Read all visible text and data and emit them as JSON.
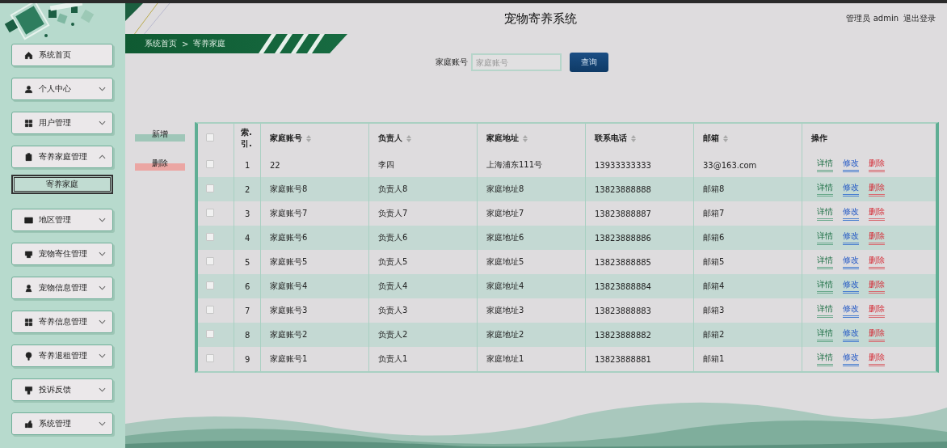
{
  "header": {
    "title": "宠物寄养系统",
    "user": "管理员 admin",
    "logout": "退出登录"
  },
  "breadcrumb": [
    "系统首页",
    ">",
    "寄养家庭"
  ],
  "sidebar": {
    "items": [
      {
        "label": "系统首页",
        "kind": "link"
      },
      {
        "label": "个人中心",
        "kind": "menu",
        "expanded": false
      },
      {
        "label": "用户管理",
        "kind": "menu",
        "expanded": false
      },
      {
        "label": "寄养家庭管理",
        "kind": "menu",
        "expanded": true,
        "children": [
          {
            "label": "寄养家庭",
            "selected": true
          }
        ]
      },
      {
        "label": "地区管理",
        "kind": "menu",
        "expanded": false
      },
      {
        "label": "宠物寄住管理",
        "kind": "menu",
        "expanded": false
      },
      {
        "label": "宠物信息管理",
        "kind": "menu",
        "expanded": false
      },
      {
        "label": "寄养信息管理",
        "kind": "menu",
        "expanded": false
      },
      {
        "label": "寄养退租管理",
        "kind": "menu",
        "expanded": false
      },
      {
        "label": "投诉反馈",
        "kind": "menu",
        "expanded": false
      },
      {
        "label": "系统管理",
        "kind": "menu",
        "expanded": false
      }
    ]
  },
  "search": {
    "label": "家庭账号",
    "placeholder": "家庭账号",
    "button": "查询"
  },
  "actions": [
    {
      "label": "新增",
      "kind": "add"
    },
    {
      "label": "删除",
      "kind": "delete"
    }
  ],
  "table": {
    "header_checked": false,
    "columns": [
      {
        "label": "索.引.",
        "sortable": false
      },
      {
        "label": "家庭账号",
        "sortable": true
      },
      {
        "label": "负责人",
        "sortable": true
      },
      {
        "label": "家庭地址",
        "sortable": true
      },
      {
        "label": "联系电话",
        "sortable": true
      },
      {
        "label": "邮箱",
        "sortable": true
      },
      {
        "label": "操作",
        "sortable": false
      }
    ],
    "rows": [
      {
        "checked": false,
        "cells": [
          "1",
          "22",
          "李四",
          "上海浦东111号",
          "13933333333",
          "33@163.com"
        ],
        "actions": [
          {
            "label": "详情",
            "kind": "detail"
          },
          {
            "label": "修改",
            "kind": "edit"
          },
          {
            "label": "删除",
            "kind": "delete"
          }
        ]
      },
      {
        "checked": false,
        "cells": [
          "2",
          "家庭账号8",
          "负责人8",
          "家庭地址8",
          "13823888888",
          "邮箱8"
        ],
        "actions": [
          {
            "label": "详情",
            "kind": "detail"
          },
          {
            "label": "修改",
            "kind": "edit"
          },
          {
            "label": "删除",
            "kind": "delete"
          }
        ]
      },
      {
        "checked": false,
        "cells": [
          "3",
          "家庭账号7",
          "负责人7",
          "家庭地址7",
          "13823888887",
          "邮箱7"
        ],
        "actions": [
          {
            "label": "详情",
            "kind": "detail"
          },
          {
            "label": "修改",
            "kind": "edit"
          },
          {
            "label": "删除",
            "kind": "delete"
          }
        ]
      },
      {
        "checked": false,
        "cells": [
          "4",
          "家庭账号6",
          "负责人6",
          "家庭地址6",
          "13823888886",
          "邮箱6"
        ],
        "actions": [
          {
            "label": "详情",
            "kind": "detail"
          },
          {
            "label": "修改",
            "kind": "edit"
          },
          {
            "label": "删除",
            "kind": "delete"
          }
        ]
      },
      {
        "checked": false,
        "cells": [
          "5",
          "家庭账号5",
          "负责人5",
          "家庭地址5",
          "13823888885",
          "邮箱5"
        ],
        "actions": [
          {
            "label": "详情",
            "kind": "detail"
          },
          {
            "label": "修改",
            "kind": "edit"
          },
          {
            "label": "删除",
            "kind": "delete"
          }
        ]
      },
      {
        "checked": false,
        "cells": [
          "6",
          "家庭账号4",
          "负责人4",
          "家庭地址4",
          "13823888884",
          "邮箱4"
        ],
        "actions": [
          {
            "label": "详情",
            "kind": "detail"
          },
          {
            "label": "修改",
            "kind": "edit"
          },
          {
            "label": "删除",
            "kind": "delete"
          }
        ]
      },
      {
        "checked": false,
        "cells": [
          "7",
          "家庭账号3",
          "负责人3",
          "家庭地址3",
          "13823888883",
          "邮箱3"
        ],
        "actions": [
          {
            "label": "详情",
            "kind": "detail"
          },
          {
            "label": "修改",
            "kind": "edit"
          },
          {
            "label": "删除",
            "kind": "delete"
          }
        ]
      },
      {
        "checked": false,
        "cells": [
          "8",
          "家庭账号2",
          "负责人2",
          "家庭地址2",
          "13823888882",
          "邮箱2"
        ],
        "actions": [
          {
            "label": "详情",
            "kind": "detail"
          },
          {
            "label": "修改",
            "kind": "edit"
          },
          {
            "label": "删除",
            "kind": "delete"
          }
        ]
      },
      {
        "checked": false,
        "cells": [
          "9",
          "家庭账号1",
          "负责人1",
          "家庭地址1",
          "13823888881",
          "邮箱1"
        ],
        "actions": [
          {
            "label": "详情",
            "kind": "detail"
          },
          {
            "label": "修改",
            "kind": "edit"
          },
          {
            "label": "删除",
            "kind": "delete"
          }
        ]
      }
    ]
  }
}
